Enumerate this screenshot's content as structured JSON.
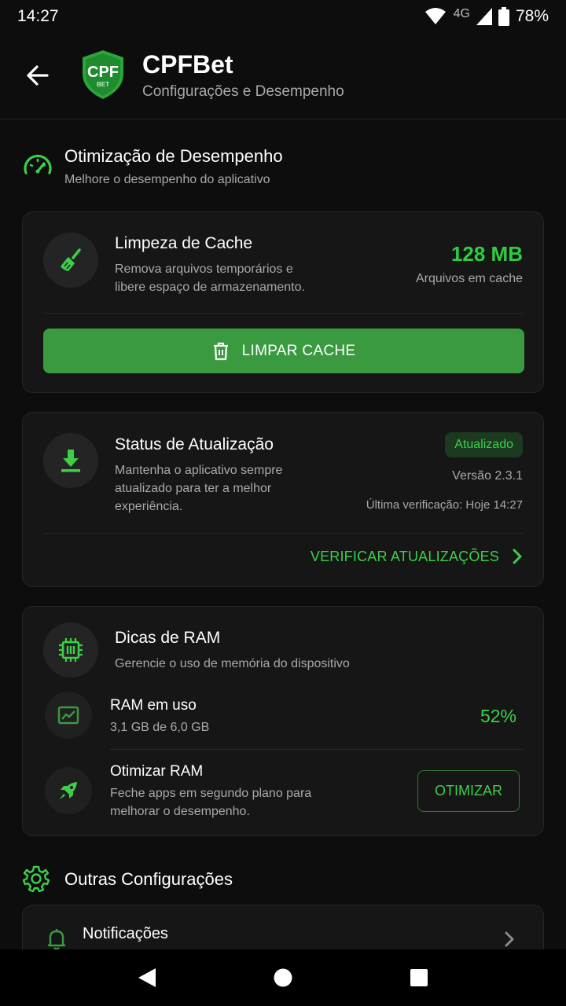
{
  "status_bar": {
    "time": "14:27",
    "network": "4G",
    "battery": "78%"
  },
  "header": {
    "title": "CPFBet",
    "subtitle": "Configurações e Desempenho",
    "logo_text": "CPF",
    "logo_subtext": "BET"
  },
  "performance_section": {
    "title": "Otimização de Desempenho",
    "subtitle": "Melhore o desempenho do aplicativo"
  },
  "cache_card": {
    "title": "Limpeza de Cache",
    "description_line1": "Remova arquivos temporários e",
    "description_line2": "libere espaço de armazenamento.",
    "size": "128 MB",
    "size_label": "Arquivos em cache",
    "button_label": "LIMPAR CACHE"
  },
  "update_card": {
    "title": "Status de Atualização",
    "description_line1": "Mantenha o aplicativo sempre",
    "description_line2": "atualizado para ter a melhor",
    "description_line3": "experiência.",
    "badge": "Atualizado",
    "version": "Versão 2.3.1",
    "last_check": "Última verificação: Hoje 14:27",
    "action_label": "VERIFICAR ATUALIZAÇÕES"
  },
  "ram_card": {
    "title": "Dicas de RAM",
    "subtitle": "Gerencie o uso de memória do dispositivo",
    "usage_title": "RAM em uso",
    "usage_detail": "3,1 GB de 6,0 GB",
    "usage_percent": "52%",
    "optimize_title": "Otimizar RAM",
    "optimize_desc_line1": "Feche apps em segundo plano para",
    "optimize_desc_line2": "melhorar o desempenho.",
    "optimize_button": "OTIMIZAR"
  },
  "other_section": {
    "title": "Outras Configurações"
  },
  "notifications": {
    "label": "Notificações"
  },
  "colors": {
    "accent": "#3ccf4a",
    "button": "#3a9a40",
    "background": "#0d0d0d",
    "card": "#161616"
  }
}
